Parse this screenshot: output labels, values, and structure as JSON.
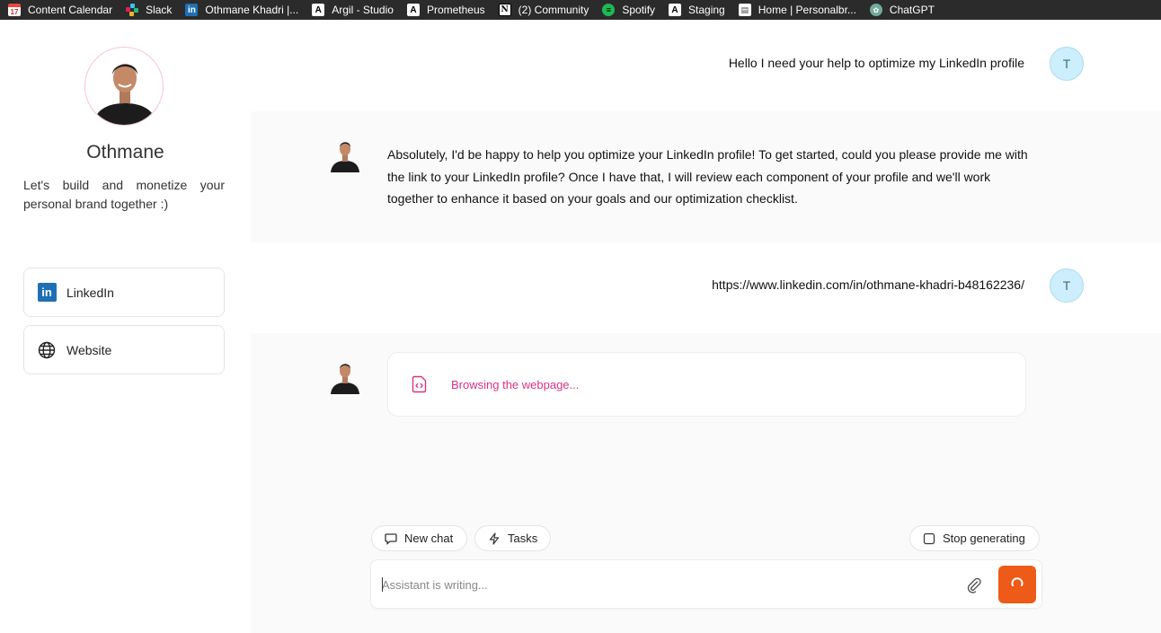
{
  "bookmarks": [
    {
      "label": "Content Calendar",
      "icon": "calendar-icon"
    },
    {
      "label": "Slack",
      "icon": "slack-icon"
    },
    {
      "label": "Othmane Khadri |...",
      "icon": "linkedin-icon"
    },
    {
      "label": "Argil - Studio",
      "icon": "argil-icon"
    },
    {
      "label": "Prometheus",
      "icon": "argil-icon"
    },
    {
      "label": "(2) Community",
      "icon": "notion-icon"
    },
    {
      "label": "Spotify",
      "icon": "spotify-icon"
    },
    {
      "label": "Staging",
      "icon": "argil-icon"
    },
    {
      "label": "Home | Personalbr...",
      "icon": "page-icon"
    },
    {
      "label": "ChatGPT",
      "icon": "chatgpt-icon"
    }
  ],
  "sidebar": {
    "name": "Othmane",
    "bio": "Let's build and monetize your personal brand together :)",
    "links": [
      {
        "label": "LinkedIn",
        "icon": "linkedin-icon"
      },
      {
        "label": "Website",
        "icon": "globe-icon"
      }
    ]
  },
  "chat": {
    "user_initial": "T",
    "messages": [
      {
        "role": "user",
        "text": "Hello I need your help to optimize my LinkedIn profile"
      },
      {
        "role": "assistant",
        "text": "Absolutely, I'd be happy to help you optimize your LinkedIn profile! To get started, could you please provide me with the link to your LinkedIn profile? Once I have that, I will review each component of your profile and we'll work together to enhance it based on your goals and our optimization checklist."
      },
      {
        "role": "user",
        "text": "https://www.linkedin.com/in/othmane-khadri-b48162236/"
      },
      {
        "role": "assistant",
        "status": "Browsing the webpage..."
      }
    ]
  },
  "controls": {
    "new_chat": "New chat",
    "tasks": "Tasks",
    "stop_generating": "Stop generating",
    "input_placeholder": "Assistant is writing...",
    "input_value": ""
  },
  "colors": {
    "accent": "#ee5a17",
    "status_pink": "#d63384",
    "user_avatar_bg": "#cdeefc"
  }
}
